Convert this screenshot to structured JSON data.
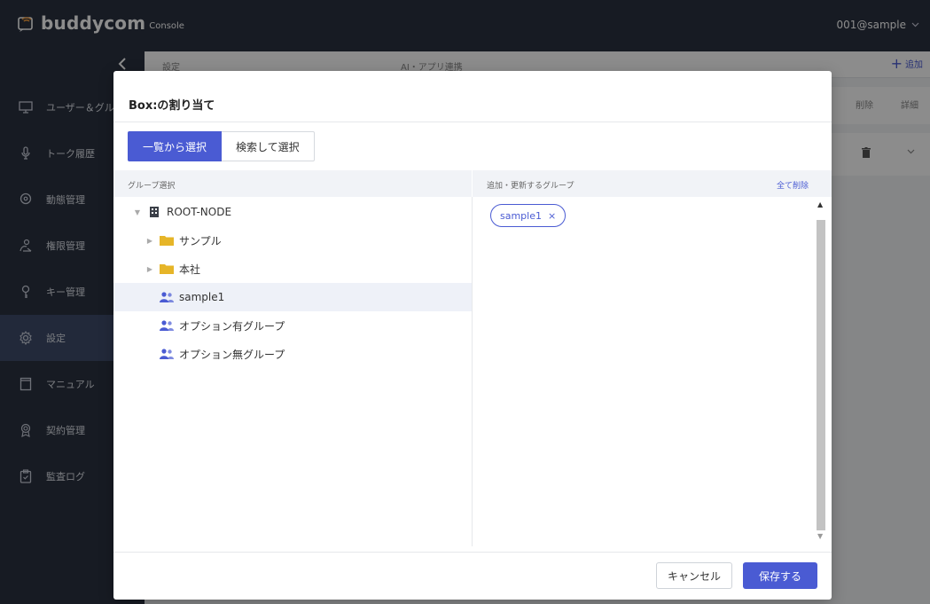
{
  "app": {
    "brand_name": "buddycom",
    "brand_sub": "Console",
    "account_label": "001@sample",
    "colors": {
      "topbar": "#2b3240",
      "accent": "#4a5bd3",
      "folder": "#e6b528",
      "group_icon": "#4a5bd3"
    }
  },
  "sidebar": {
    "collapse_icon": "chevron-left-icon",
    "items": [
      {
        "label": "ユーザー＆グル",
        "icon": "monitor-icon"
      },
      {
        "label": "トーク履歴",
        "icon": "microphone-icon"
      },
      {
        "label": "動態管理",
        "icon": "location-pin-icon"
      },
      {
        "label": "権限管理",
        "icon": "permission-icon"
      },
      {
        "label": "キー管理",
        "icon": "key-icon"
      },
      {
        "label": "設定",
        "icon": "gear-icon",
        "active": true
      },
      {
        "label": "マニュアル",
        "icon": "book-icon"
      },
      {
        "label": "契約管理",
        "icon": "badge-icon"
      },
      {
        "label": "監査ログ",
        "icon": "clipboard-icon"
      }
    ]
  },
  "main": {
    "col1": "設定",
    "col2": "AI・アプリ連携",
    "add_label": "追加",
    "delete_label": "削除",
    "detail_label": "詳細"
  },
  "modal": {
    "title": "Box:の割り当て",
    "tabs": [
      {
        "label": "一覧から選択",
        "active": true
      },
      {
        "label": "検索して選択",
        "active": false
      }
    ],
    "left_header": "グループ選択",
    "right_header": "追加・更新するグループ",
    "clear_all": "全て削除",
    "tree": [
      {
        "label": "ROOT-NODE",
        "type": "root",
        "toggle": "▼",
        "level": 0
      },
      {
        "label": "サンプル",
        "type": "folder",
        "toggle": "▶",
        "level": 1
      },
      {
        "label": "本社",
        "type": "folder",
        "toggle": "▶",
        "level": 1
      },
      {
        "label": "sample1",
        "type": "group",
        "toggle": "",
        "level": 1,
        "selected": true
      },
      {
        "label": "オプション有グループ",
        "type": "group",
        "toggle": "",
        "level": 1
      },
      {
        "label": "オプション無グループ",
        "type": "group",
        "toggle": "",
        "level": 1
      }
    ],
    "selected_groups": [
      {
        "label": "sample1",
        "remove": "×"
      }
    ],
    "cancel_label": "キャンセル",
    "save_label": "保存する"
  }
}
